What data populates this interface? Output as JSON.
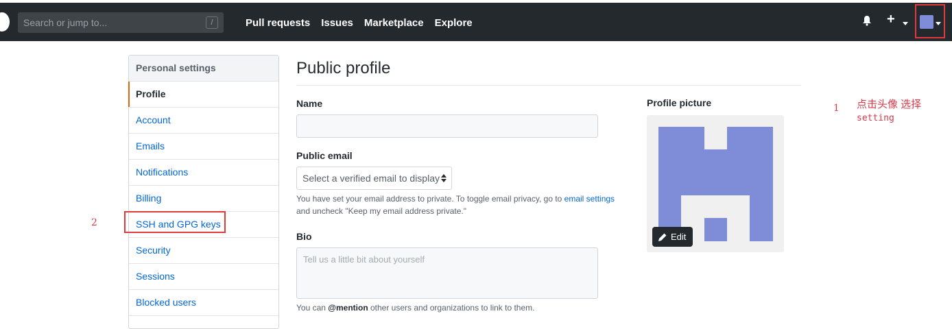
{
  "header": {
    "search_placeholder": "Search or jump to...",
    "search_shortcut": "/",
    "nav": [
      "Pull requests",
      "Issues",
      "Marketplace",
      "Explore"
    ],
    "icons": [
      "github-logo-icon",
      "bell-icon",
      "plus-icon",
      "avatar-icon"
    ]
  },
  "sidebar": {
    "heading": "Personal settings",
    "items": [
      {
        "label": "Profile",
        "active": true
      },
      {
        "label": "Account"
      },
      {
        "label": "Emails"
      },
      {
        "label": "Notifications"
      },
      {
        "label": "Billing"
      },
      {
        "label": "SSH and GPG keys"
      },
      {
        "label": "Security"
      },
      {
        "label": "Sessions"
      },
      {
        "label": "Blocked users"
      }
    ]
  },
  "main": {
    "title": "Public profile",
    "name_label": "Name",
    "name_value": "",
    "email_label": "Public email",
    "email_select": "Select a verified email to display",
    "email_note_1": "You have set your email address to private. To toggle email privacy, go to",
    "email_note_link": "email settings",
    "email_note_2": "and uncheck \"Keep my email address private.\"",
    "bio_label": "Bio",
    "bio_placeholder": "Tell us a little bit about yourself",
    "bio_note_1": "You can",
    "bio_note_mention": "@mention",
    "bio_note_2": "other users and organizations to link to them.",
    "picture_label": "Profile picture",
    "edit_button": "Edit"
  },
  "annotations": {
    "num_1": "1",
    "text_1": "点击头像 选择",
    "text_1_sub": "setting",
    "num_2": "2"
  },
  "colors": {
    "header_bg": "#24292e",
    "avatar": "#7f8cd8",
    "annotation_red": "#e03a3a",
    "link": "#0366d6",
    "active_indicator": "#e36209"
  }
}
